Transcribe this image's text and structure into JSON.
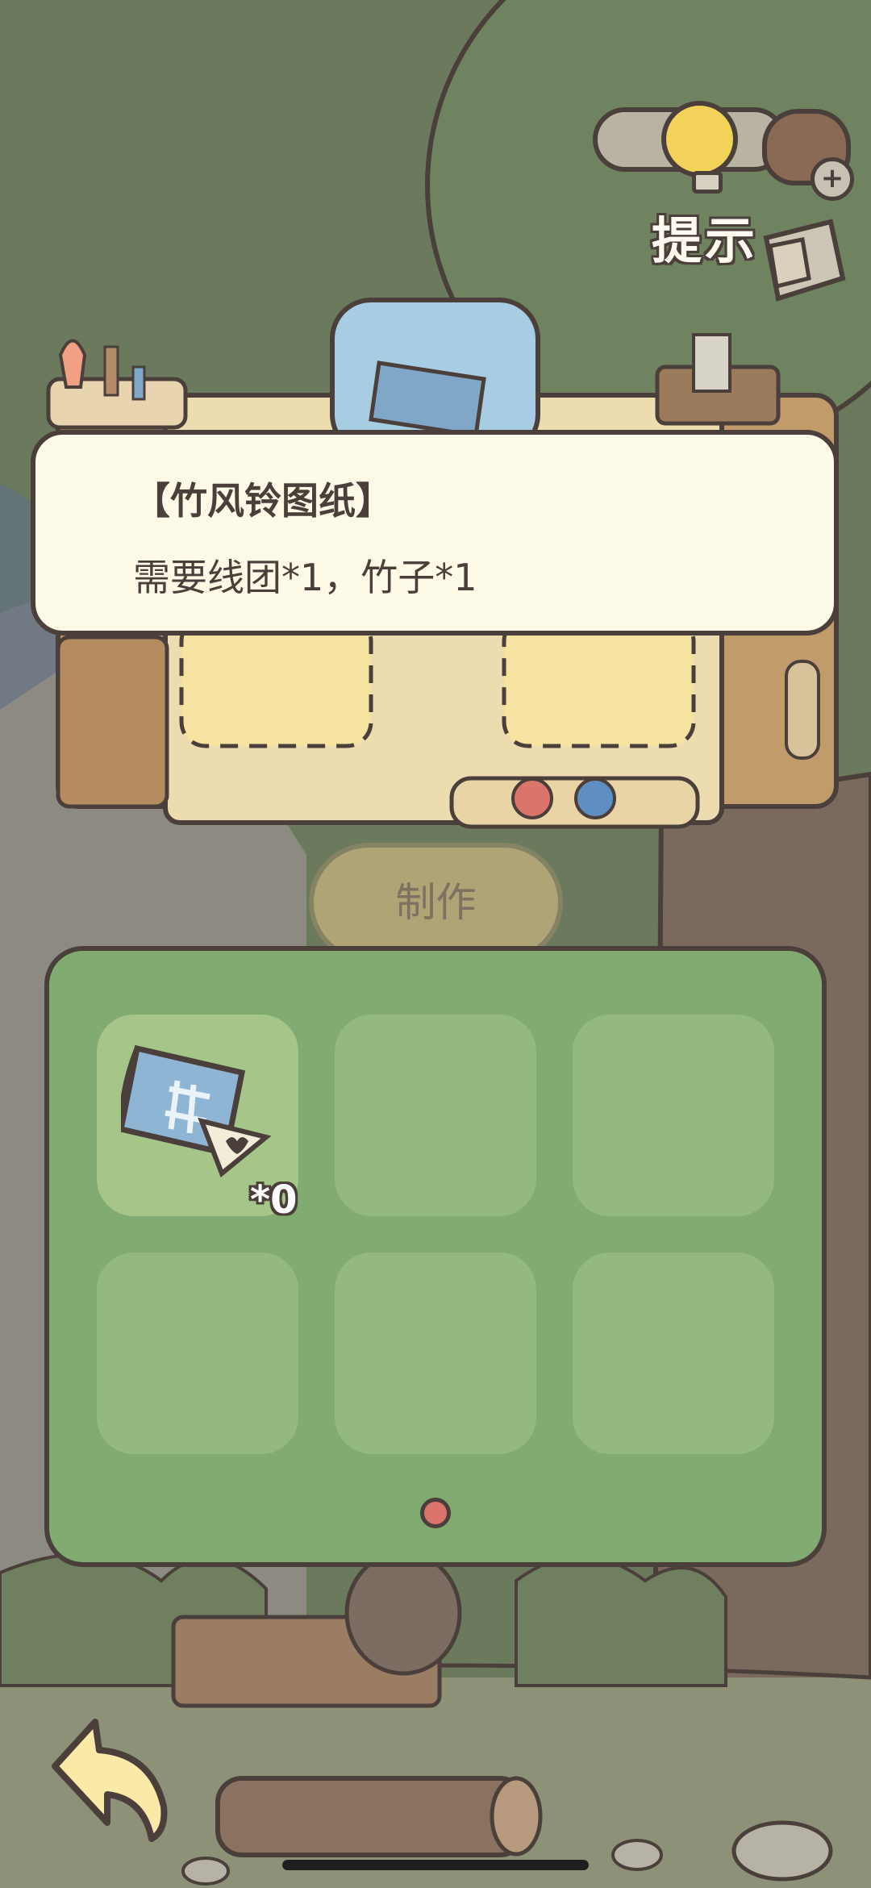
{
  "hint": {
    "label": "提示",
    "icons": [
      "lightbulb-icon",
      "acorn-bag-icon",
      "plus-icon",
      "scroll-note-icon"
    ]
  },
  "tooltip": {
    "title": "【竹风铃图纸】",
    "description": "需要线团*1，竹子*1"
  },
  "workbench": {
    "make_label": "制作"
  },
  "inventory": {
    "slots": [
      {
        "item_icon": "bamboo-windchime-blueprint-icon",
        "count": "*0"
      },
      {
        "item_icon": "",
        "count": ""
      },
      {
        "item_icon": "",
        "count": ""
      },
      {
        "item_icon": "",
        "count": ""
      },
      {
        "item_icon": "",
        "count": ""
      },
      {
        "item_icon": "",
        "count": ""
      }
    ],
    "page_indicator_color": "#d9756a"
  },
  "navigation": {
    "back_icon": "back-arrow-icon"
  },
  "colors": {
    "outline": "#4a3f3a",
    "tooltip_bg": "#fdfbe8",
    "panel_bg": "#82ab71",
    "slot_bg": "#94b97f",
    "background_green": "#6b7a5c"
  }
}
